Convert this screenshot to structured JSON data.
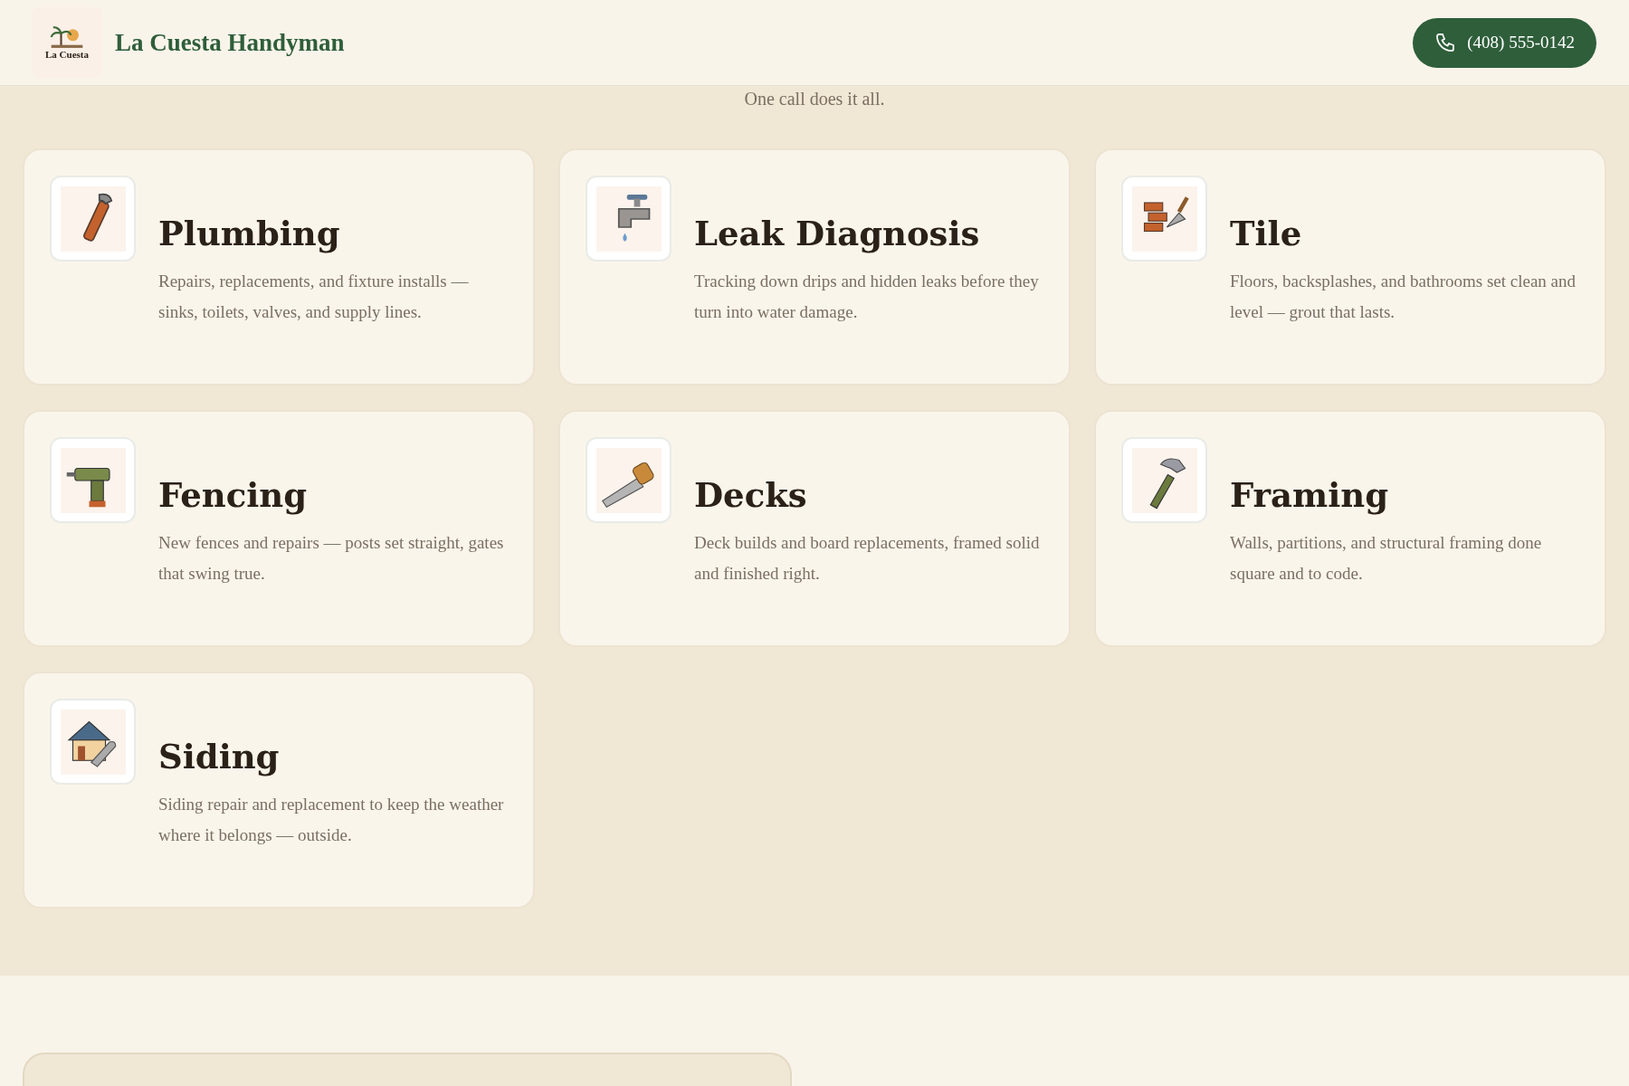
{
  "header": {
    "logo_text": "La Cuesta",
    "brand": "La Cuesta Handyman",
    "phone": "(408) 555-0142"
  },
  "section": {
    "subtitle": "One call does it all."
  },
  "services": [
    {
      "title": "Plumbing",
      "description": "Repairs, replacements, and fixture installs — sinks, toilets, valves, and supply lines."
    },
    {
      "title": "Leak Diagnosis",
      "description": "Tracking down drips and hidden leaks before they turn into water damage."
    },
    {
      "title": "Tile",
      "description": "Floors, backsplashes, and bathrooms set clean and level — grout that lasts."
    },
    {
      "title": "Fencing",
      "description": "New fences and repairs — posts set straight, gates that swing true."
    },
    {
      "title": "Decks",
      "description": "Deck builds and board replacements, framed solid and finished right."
    },
    {
      "title": "Framing",
      "description": "Walls, partitions, and structural framing done square and to code."
    },
    {
      "title": "Siding",
      "description": "Siding repair and replacement to keep the weather where it belongs — outside."
    }
  ]
}
